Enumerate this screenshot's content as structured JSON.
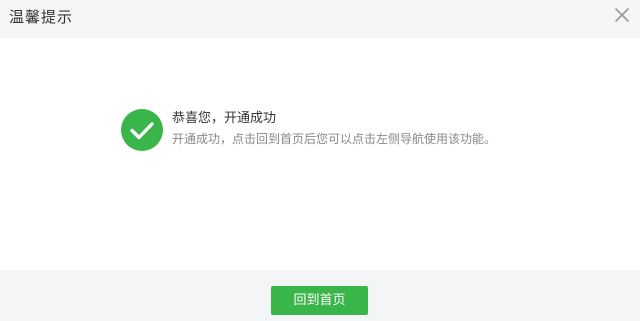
{
  "dialog": {
    "title": "温馨提示"
  },
  "message": {
    "title": "恭喜您，开通成功",
    "description": "开通成功，点击回到首页后您可以点击左侧导航使用该功能。"
  },
  "footer": {
    "home_label": "回到首页"
  },
  "icons": {
    "close": "close-icon",
    "success": "check-circle-icon"
  },
  "colors": {
    "success": "#3ab54a",
    "header_bg": "#f4f5f7",
    "footer_bg": "#f4f5f7"
  }
}
